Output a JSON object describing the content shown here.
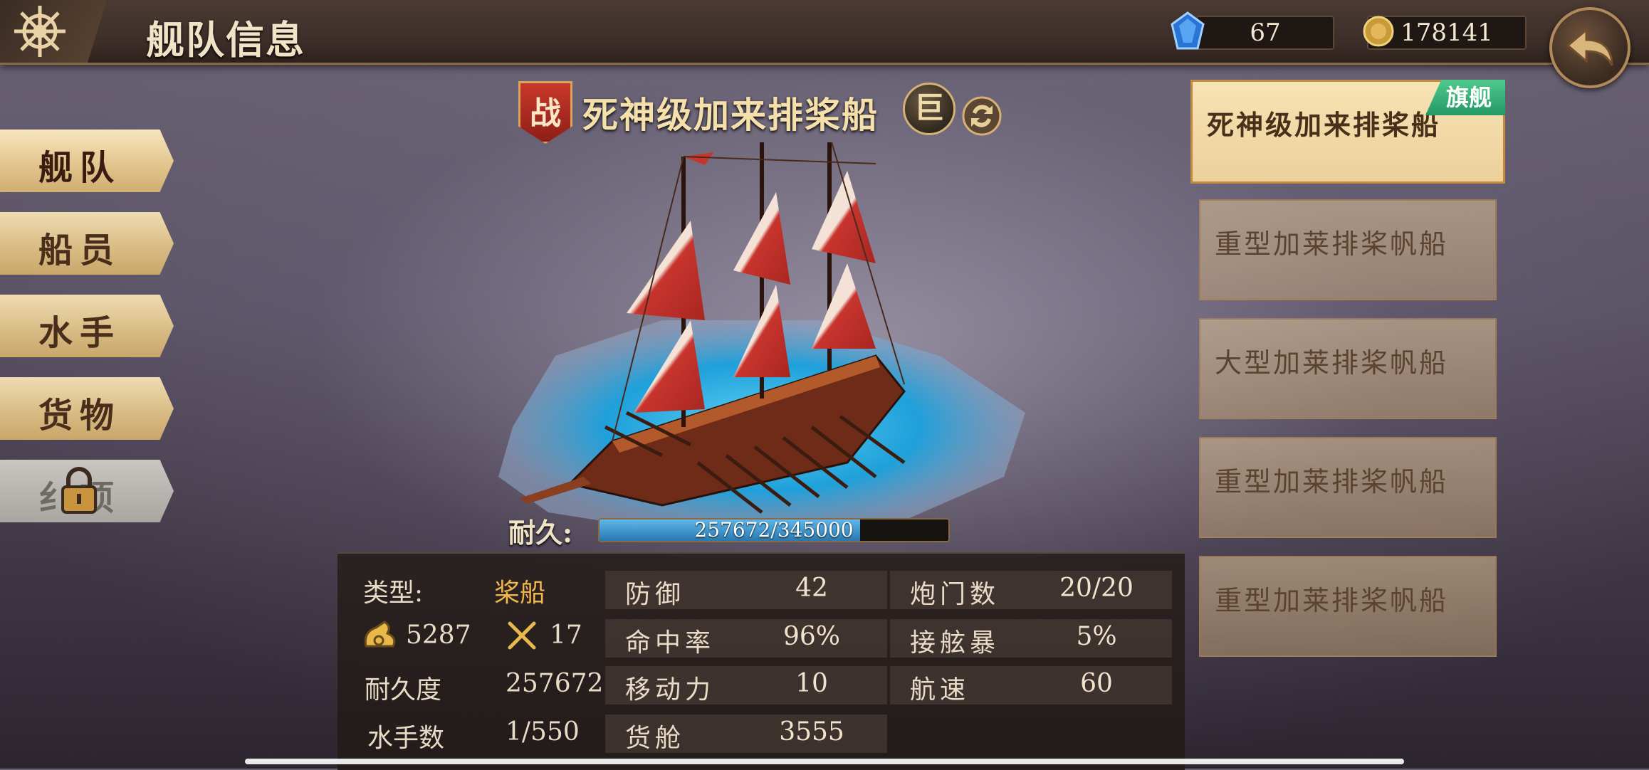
{
  "header": {
    "title": "舰队信息"
  },
  "resources": {
    "gems": "67",
    "gold": "178141"
  },
  "nav": {
    "items": [
      {
        "label": "舰队"
      },
      {
        "label": "船员"
      },
      {
        "label": "水手"
      },
      {
        "label": "货物"
      },
      {
        "label": "纟项"
      }
    ]
  },
  "ship": {
    "battle_badge": "战",
    "name": "死神级加来排桨船",
    "size_badge": "巨",
    "durability_label": "耐久:",
    "durability_text": "257672/345000",
    "durability_fraction": 0.747
  },
  "stats": {
    "type_label": "类型:",
    "type_value": "桨船",
    "supply_value": "5287",
    "attack_value": "17",
    "endurance_label": "耐久度",
    "endurance_value": "257672",
    "sailors_label": "水手数",
    "sailors_value": "1/550",
    "cells": [
      {
        "key": "防御",
        "value": "42"
      },
      {
        "key": "命中率",
        "value": "96%"
      },
      {
        "key": "移动力",
        "value": "10"
      },
      {
        "key": "货舱",
        "value": "3555"
      },
      {
        "key": "炮门数",
        "value": "20/20"
      },
      {
        "key": "接舷暴",
        "value": "5%"
      },
      {
        "key": "航速",
        "value": "60"
      }
    ]
  },
  "fleet": {
    "flag_label": "旗舰",
    "ships": [
      {
        "name": "死神级加来排桨船"
      },
      {
        "name": "重型加莱排桨帆船"
      },
      {
        "name": "大型加莱排桨帆船"
      },
      {
        "name": "重型加莱排桨帆船"
      },
      {
        "name": "重型加莱排桨帆船"
      }
    ]
  },
  "colors": {
    "accent_gold": "#f0b64a",
    "flag_green": "#2fb878",
    "sail_red": "#c8342e"
  },
  "icons": [
    "ship-wheel-icon",
    "gem-icon",
    "gold-coin-icon",
    "back-arrow-icon",
    "lock-icon",
    "swap-icon",
    "supply-icon",
    "crossed-swords-icon"
  ]
}
